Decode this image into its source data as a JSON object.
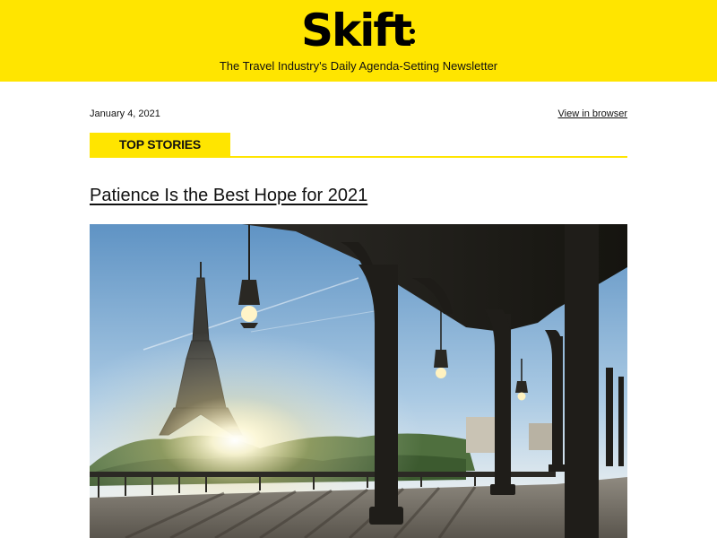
{
  "header": {
    "logo_text": "Skift",
    "tagline": "The Travel Industry's Daily Agenda-Setting Newsletter",
    "background_color": "#ffe500"
  },
  "meta": {
    "date": "January 4, 2021",
    "view_in_browser": "View in browser"
  },
  "section": {
    "label": "TOP STORIES",
    "accent_color": "#ffe500"
  },
  "story": {
    "headline": "Patience Is the Best Hope for 2021",
    "image_icon": "eiffel-tower-bridge-photo"
  }
}
